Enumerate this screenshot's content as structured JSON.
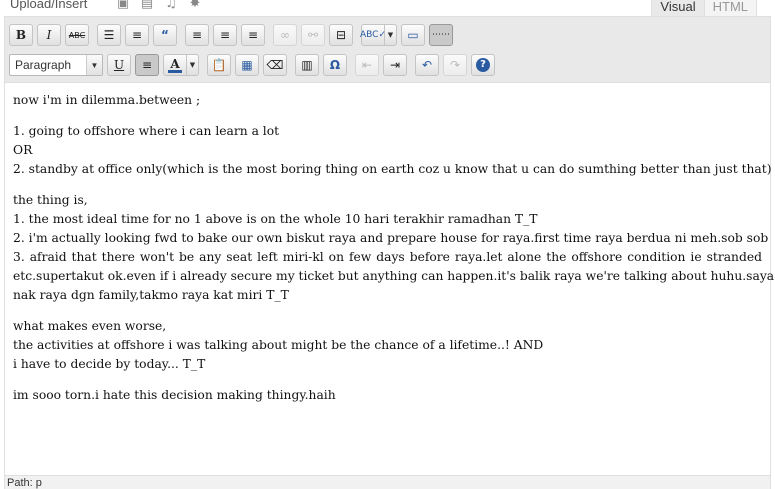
{
  "header": {
    "upload_label": "Upload/Insert",
    "media_icons": [
      "image-icon",
      "video-icon",
      "audio-icon",
      "media-icon"
    ],
    "tabs": [
      {
        "label": "Visual",
        "active": true
      },
      {
        "label": "HTML",
        "active": false
      }
    ]
  },
  "toolbar": {
    "format_select": "Paragraph",
    "text_color": "#2a5aa0"
  },
  "content": {
    "paragraphs": [
      [
        "now i'm in dilemma.between ;"
      ],
      [
        "1. going to offshore where i can learn a lot",
        "OR",
        "2. standby at office only(which is the most boring thing on earth coz u know that u can do sumthing better than just that)"
      ],
      [
        "the thing is,",
        "1. the most ideal time for no 1 above is on the whole 10 hari terakhir ramadhan T_T",
        "2. i'm actually looking fwd to bake our own biskut raya and prepare house for raya.first time raya berdua ni meh.sob sob",
        "3. afraid that there won't be any seat left miri-kl on few days before raya.let alone the offshore condition ie stranded",
        "etc.supertakut ok.even if i already secure my ticket but anything can happen.it's balik raya we're talking about huhu.saya",
        "nak raya dgn family,takmo raya kat miri T_T"
      ],
      [
        "what makes even worse,",
        "the activities at offshore i was talking about might be the chance of a lifetime..! AND",
        "i have to decide by today... T_T"
      ],
      [
        "im sooo torn.i hate this decision making thingy.haih"
      ]
    ]
  },
  "status": {
    "path_label": "Path: p"
  }
}
